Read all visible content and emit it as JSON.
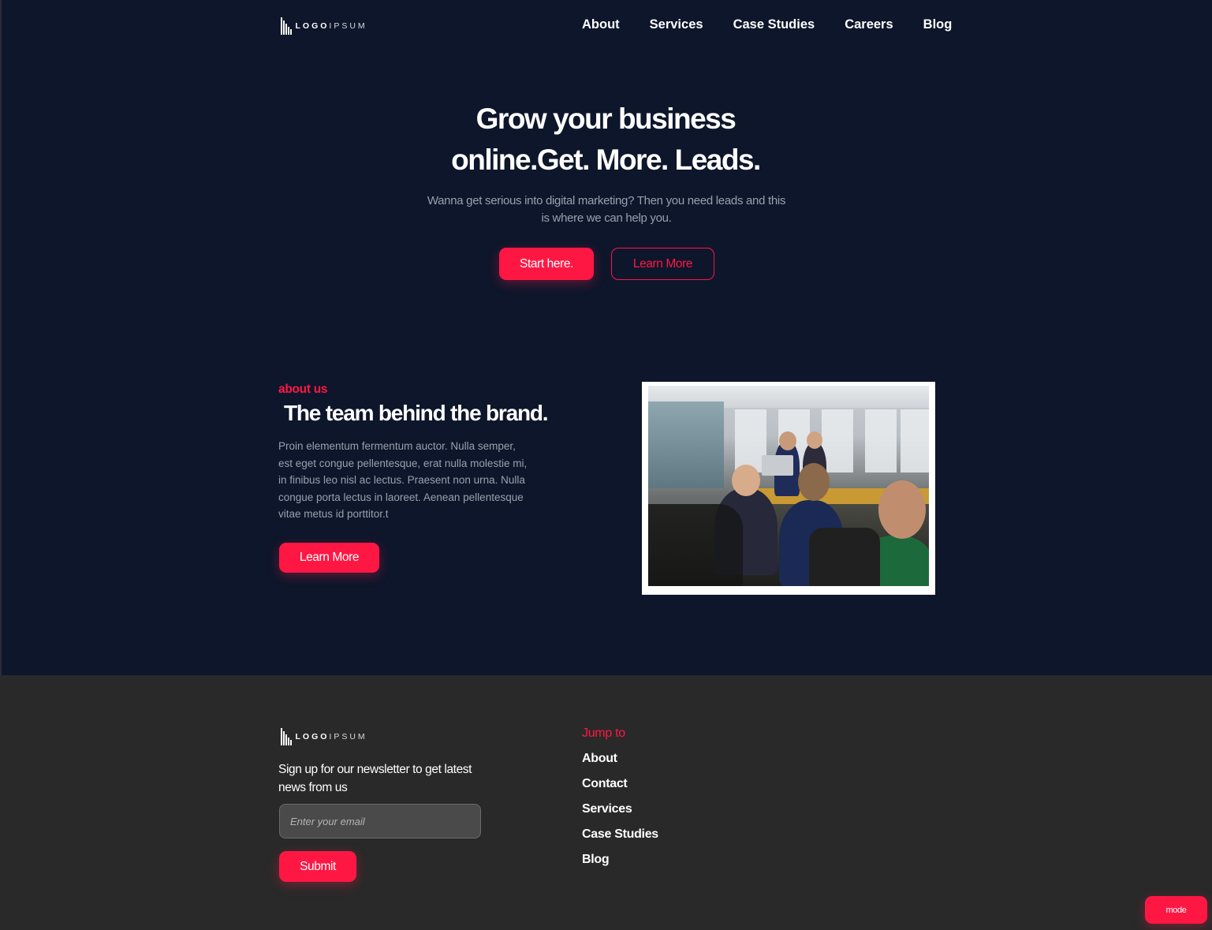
{
  "colors": {
    "background": "#0e162b",
    "footer": "#292929",
    "accent": "#ff1744",
    "muted_text": "#9aa0ae"
  },
  "brand": {
    "logo_bold": "LOGO",
    "logo_light": "IPSUM",
    "icon": "logo-icon"
  },
  "nav": {
    "links": [
      "About",
      "Services",
      "Case Studies",
      "Careers",
      "Blog"
    ]
  },
  "hero": {
    "title_line1": "Grow your business",
    "title_line2": "online.Get. More. Leads.",
    "subtitle": "Wanna get serious into digital marketing? Then you need leads and this is where we can help you.",
    "primary_cta": "Start here.",
    "secondary_cta": "Learn More"
  },
  "about": {
    "eyebrow": "about us",
    "title": "The team behind the brand.",
    "body": "Proin elementum fermentum auctor. Nulla semper, est eget congue pellentesque, erat nulla molestie mi, in finibus leo nisl ac lectus. Praesent non urna. Nulla congue porta lectus in laoreet. Aenean pellentesque vitae metus id porttitor.t",
    "cta": "Learn More",
    "image": "team-office-photo"
  },
  "footer": {
    "blurb": "Sign up for our newsletter to get latest news from us",
    "email_placeholder": "Enter your email",
    "submit_label": "Submit",
    "jump_title": "Jump to",
    "jump_links": [
      "About",
      "Contact",
      "Services",
      "Case Studies",
      "Blog"
    ]
  },
  "mode_button": "mode"
}
